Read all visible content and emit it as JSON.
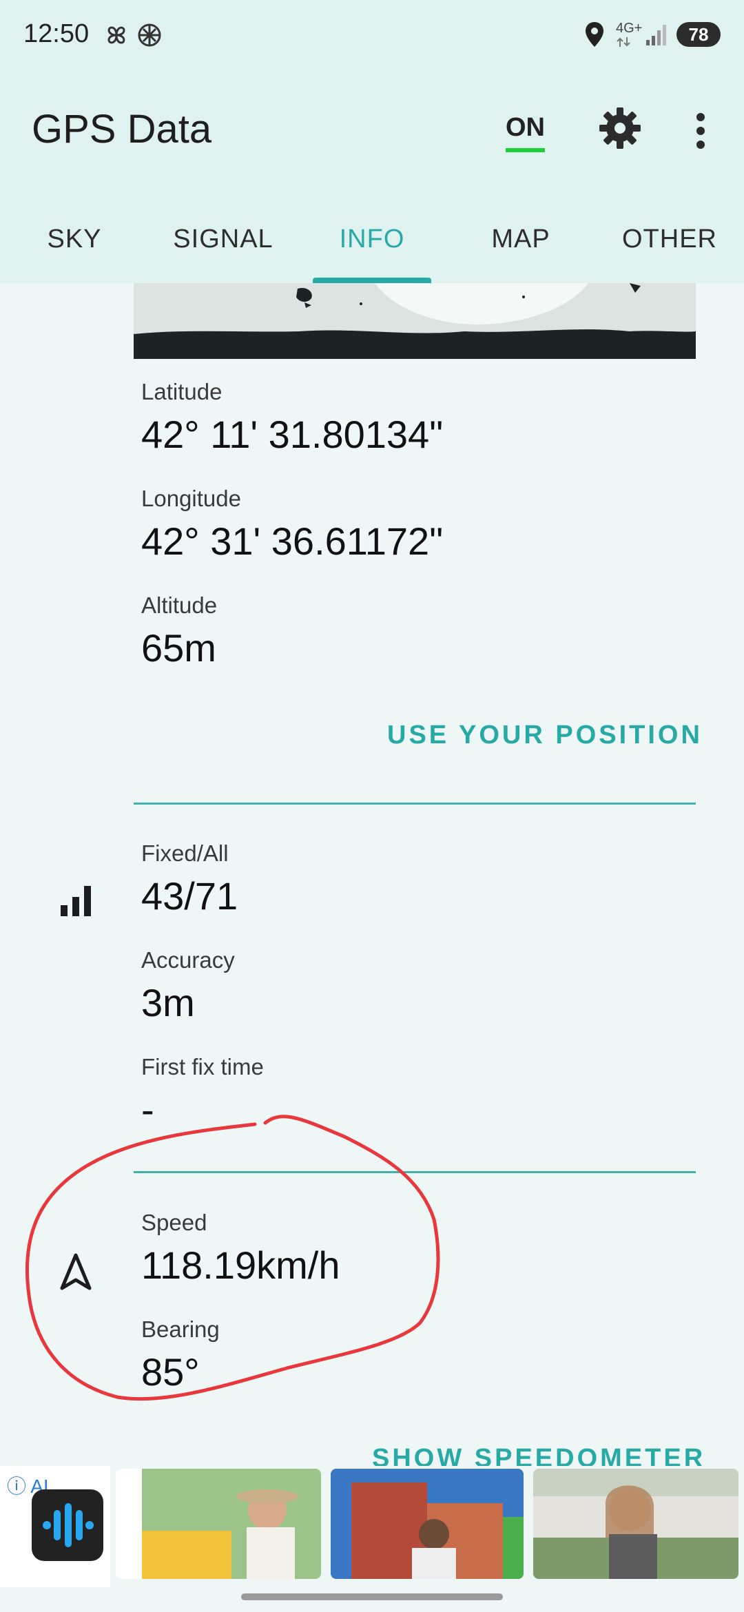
{
  "status_bar": {
    "time": "12:50",
    "network": "4G+",
    "battery": "78"
  },
  "app_bar": {
    "title": "GPS Data",
    "toggle_label": "ON"
  },
  "tabs": [
    {
      "label": "SKY",
      "active": false
    },
    {
      "label": "SIGNAL",
      "active": false
    },
    {
      "label": "INFO",
      "active": true
    },
    {
      "label": "MAP",
      "active": false
    },
    {
      "label": "OTHER",
      "active": false
    }
  ],
  "position": {
    "latitude_label": "Latitude",
    "latitude_value": "42° 11' 31.80134\"",
    "longitude_label": "Longitude",
    "longitude_value": "42° 31' 36.61172\"",
    "altitude_label": "Altitude",
    "altitude_value": "65m",
    "action": "USE YOUR POSITION"
  },
  "signal": {
    "fixed_all_label": "Fixed/All",
    "fixed_all_value": "43/71",
    "accuracy_label": "Accuracy",
    "accuracy_value": "3m",
    "first_fix_label": "First fix time",
    "first_fix_value": "-"
  },
  "motion": {
    "speed_label": "Speed",
    "speed_value": "118.19km/h",
    "bearing_label": "Bearing",
    "bearing_value": "85°",
    "action": "SHOW SPEEDOMETER"
  },
  "ad": {
    "label": "AI"
  },
  "colors": {
    "accent": "#27aaa6",
    "header_bg": "#dff2ef",
    "page_bg": "#eef7f5",
    "toggle_on": "#1ecf3a",
    "annotation": "#e8383d"
  }
}
